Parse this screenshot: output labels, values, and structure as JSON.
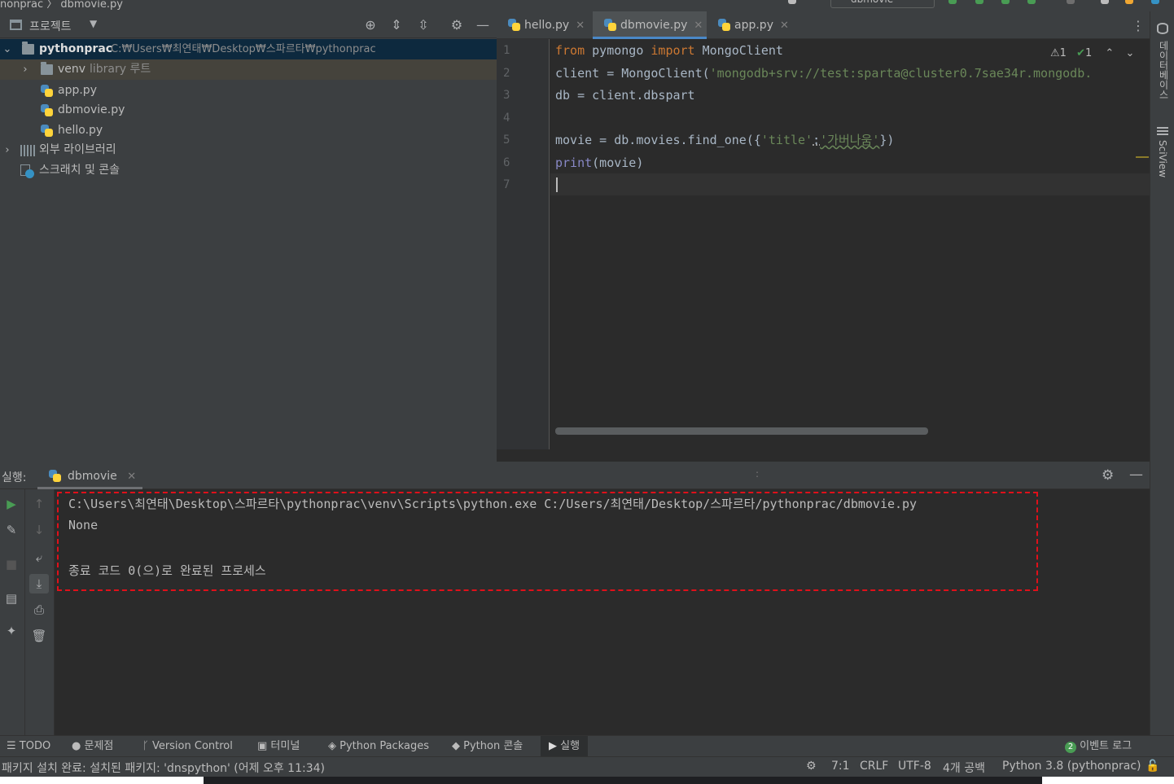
{
  "top": {
    "breadcrumb": "nonprac 〉 dbmovie.py",
    "run_config": "dbmovie"
  },
  "project": {
    "header_title": "프로젝트",
    "tree": [
      {
        "label": "pythonprac",
        "hint": "C:₩Users₩최연태₩Desktop₩스파르타₩pythonprac"
      },
      {
        "label": "venv",
        "hint": "library 루트"
      },
      {
        "label": "app.py",
        "hint": ""
      },
      {
        "label": "dbmovie.py",
        "hint": ""
      },
      {
        "label": "hello.py",
        "hint": ""
      },
      {
        "label": "외부 라이브러리",
        "hint": ""
      },
      {
        "label": "스크래치 및 콘솔",
        "hint": ""
      }
    ]
  },
  "editor": {
    "tabs": [
      {
        "label": "hello.py"
      },
      {
        "label": "dbmovie.py"
      },
      {
        "label": "app.py"
      }
    ],
    "line_numbers": [
      "1",
      "2",
      "3",
      "4",
      "5",
      "6",
      "7"
    ],
    "code": {
      "l1": {
        "a": "from",
        "b": " pymongo ",
        "c": "import",
        "d": " MongoClient"
      },
      "l2": {
        "a": "client = MongoClient(",
        "b": "'mongodb+srv://test:sparta@cluster0.7sae34r.mongodb."
      },
      "l3": {
        "a": "db = client.dbspart"
      },
      "l5": {
        "a": "movie = db.movies.find_one({",
        "b": "'title'",
        "c": ":",
        "d": "'가버나움'",
        "e": "})"
      },
      "l6": {
        "a": "print",
        "b": "(movie)"
      }
    },
    "inspections": {
      "warnings": "1",
      "ok": "1"
    }
  },
  "right_strip": {
    "database": "데이터베이스",
    "sciview": "SciView"
  },
  "run": {
    "label": "실행:",
    "tab": "dbmovie",
    "console": [
      "C:\\Users\\최연태\\Desktop\\스파르타\\pythonprac\\venv\\Scripts\\python.exe C:/Users/최연태/Desktop/스파르타/pythonprac/dbmovie.py",
      "None",
      "",
      "종료 코드 0(으)로 완료된 프로세스"
    ]
  },
  "toolwindows": [
    {
      "label": "TODO"
    },
    {
      "label": "문제점"
    },
    {
      "label": "Version Control"
    },
    {
      "label": "터미널"
    },
    {
      "label": "Python Packages"
    },
    {
      "label": "Python 콘솔"
    },
    {
      "label": "실행"
    }
  ],
  "event_log": {
    "count": "2",
    "label": "이벤트 로그"
  },
  "status": {
    "message": "패키지 설치 완료: 설치된 패키지: 'dnspython' (어제 오후 11:34)",
    "position": "7:1",
    "line_sep": "CRLF",
    "encoding": "UTF-8",
    "indent": "4개 공백",
    "interpreter": "Python 3.8 (pythonprac)"
  },
  "colors": {
    "keyword": "#cc7832",
    "string": "#6a8759",
    "builtin": "#8888c6",
    "highlight_border": "#e0101a"
  }
}
